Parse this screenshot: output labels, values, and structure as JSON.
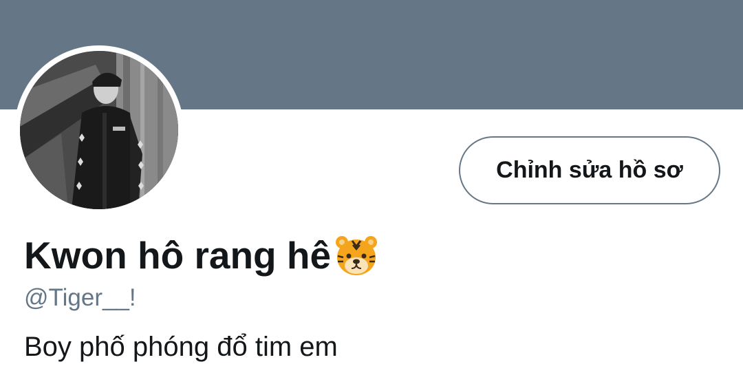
{
  "profile": {
    "display_name": "Kwon hô rang hê",
    "name_emoji": "tiger-face-emoji",
    "handle": "@Tiger__!",
    "bio": "Boy phố phóng đổ tim em",
    "edit_button_label": "Chỉnh sửa hồ sơ"
  },
  "colors": {
    "banner": "#657786",
    "text_primary": "#14171a",
    "text_secondary": "#657786",
    "button_border": "#657786"
  }
}
